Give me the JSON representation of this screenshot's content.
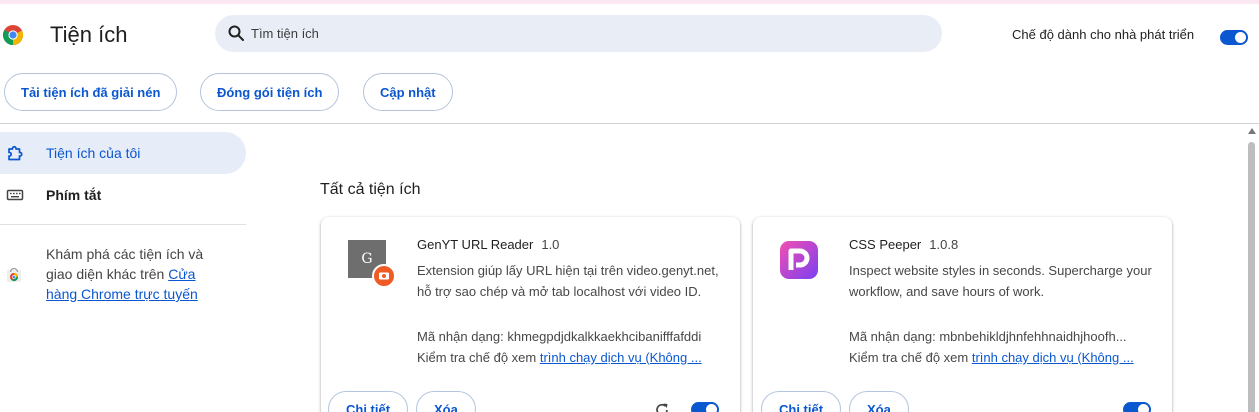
{
  "header": {
    "title": "Tiện ích",
    "search_placeholder": "Tìm tiện ích",
    "dev_mode_label": "Chế độ dành cho nhà phát triển",
    "dev_mode_on": true
  },
  "toolbar": {
    "load_unpacked": "Tải tiện ích đã giải nén",
    "pack": "Đóng gói tiện ích",
    "update": "Cập nhật"
  },
  "sidebar": {
    "items": [
      {
        "label": "Tiện ích của tôi",
        "icon": "puzzle-icon",
        "active": true
      },
      {
        "label": "Phím tắt",
        "icon": "keyboard-icon",
        "active": false
      }
    ],
    "discover_text": "Khám phá các tiện ích và giao diện khác trên ",
    "discover_link": "Cửa hàng Chrome trực tuyến"
  },
  "main": {
    "section_title": "Tất cả tiện ích",
    "extensions": [
      {
        "name": "GenYT URL Reader",
        "version": "1.0",
        "description": "Extension giúp lấy URL hiện tại trên video.genyt.net, hỗ trợ sao chép và mở tab localhost với video ID.",
        "id_text": "Mã nhận dạng: khmegpdjdkalkkaekhcibanifffafddi",
        "inspect_prefix": "Kiểm tra chế độ xem ",
        "inspect_link": "trình chạy dịch vụ (Không ...",
        "details_label": "Chi tiết",
        "remove_label": "Xóa",
        "icon_letter": "G",
        "enabled": true
      },
      {
        "name": "CSS Peeper",
        "version": "1.0.8",
        "description": "Inspect website styles in seconds. Supercharge your workflow, and save hours of work.",
        "id_text": "Mã nhận dạng: mbnbehikldjhnfehhnaidhjhoofh...",
        "inspect_prefix": "Kiểm tra chế độ xem ",
        "inspect_link": "trình chạy dịch vụ (Không ...",
        "details_label": "Chi tiết",
        "remove_label": "Xóa",
        "enabled": true
      }
    ]
  },
  "colors": {
    "accent": "#0b57d0",
    "active_bg": "#e6ecf8",
    "search_bg": "#e9eef6"
  }
}
